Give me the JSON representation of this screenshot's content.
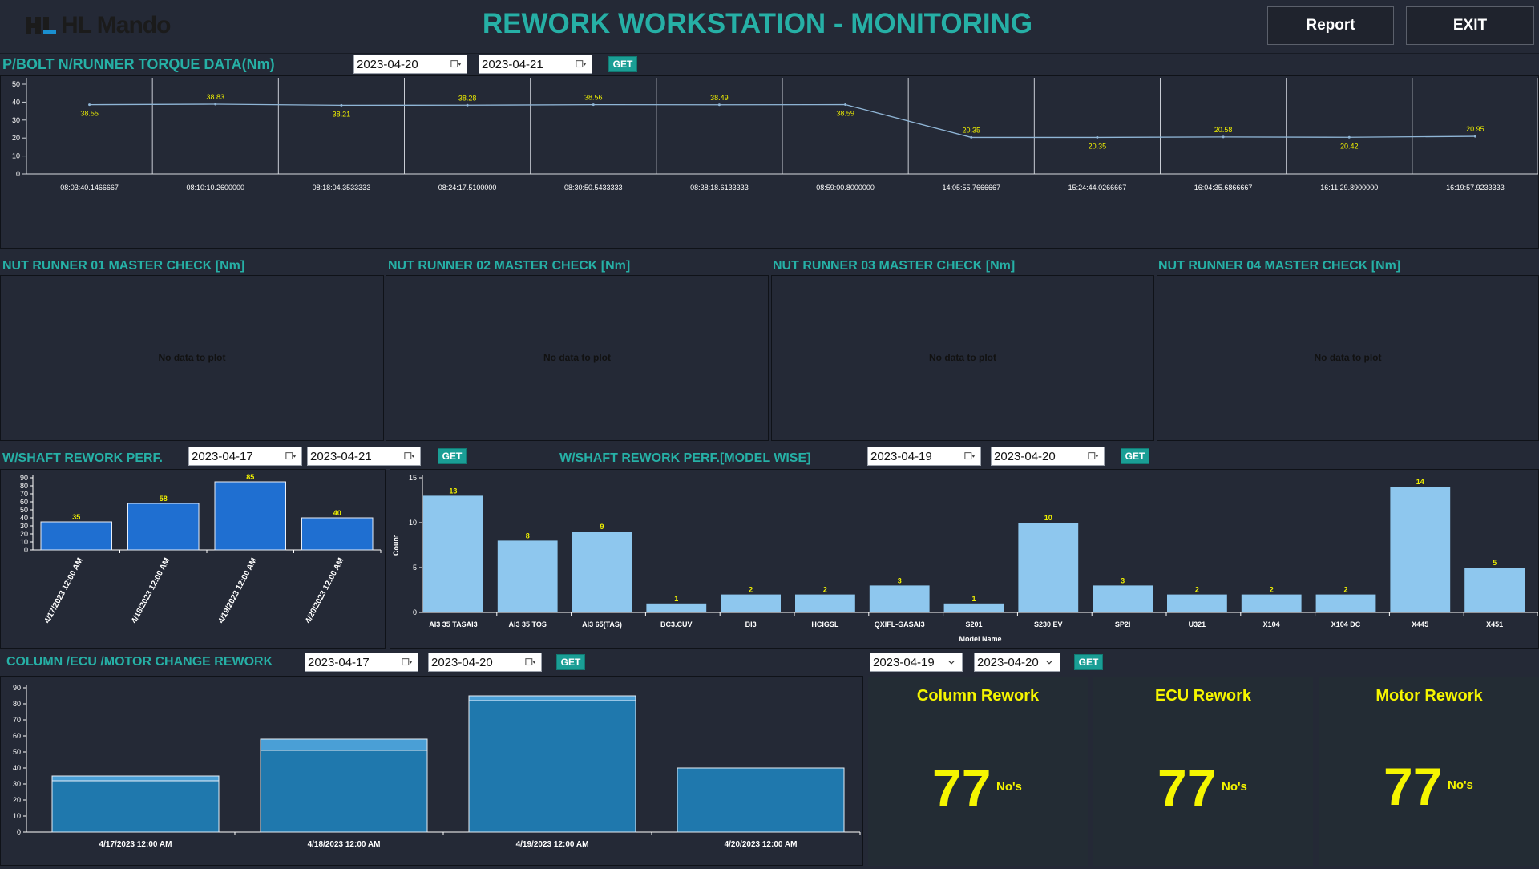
{
  "header": {
    "logo_text": "HL Mando",
    "title": "REWORK WORKSTATION - MONITORING",
    "report_label": "Report",
    "exit_label": "EXIT"
  },
  "torque": {
    "title": "P/BOLT N/RUNNER TORQUE DATA(Nm)",
    "from": "2023-04-20",
    "to": "2023-04-21",
    "get_label": "GET",
    "chart_data": {
      "type": "line",
      "x": [
        "08:03:40.1466667",
        "08:10:10.2600000",
        "08:18:04.3533333",
        "08:24:17.5100000",
        "08:30:50.5433333",
        "08:38:18.6133333",
        "08:59:00.8000000",
        "14:05:55.7666667",
        "15:24:44.0266667",
        "16:04:35.6866667",
        "16:11:29.8900000",
        "16:19:57.9233333"
      ],
      "values": [
        38.55,
        38.83,
        38.21,
        38.28,
        38.56,
        38.49,
        38.59,
        20.35,
        20.35,
        20.58,
        20.42,
        20.95
      ],
      "yticks": [
        0,
        10,
        20,
        30,
        40,
        50
      ],
      "ylim": [
        0,
        50
      ]
    }
  },
  "nutrunners": [
    {
      "title": "NUT RUNNER 01 MASTER CHECK [Nm]",
      "message": "No data to plot"
    },
    {
      "title": "NUT RUNNER 02 MASTER CHECK [Nm]",
      "message": "No data to plot"
    },
    {
      "title": "NUT RUNNER 03 MASTER CHECK [Nm]",
      "message": "No data to plot"
    },
    {
      "title": "NUT RUNNER 04 MASTER CHECK [Nm]",
      "message": "No data to plot"
    }
  ],
  "wshaft": {
    "title": "W/SHAFT REWORK PERF.",
    "from": "2023-04-17",
    "to": "2023-04-21",
    "get_label": "GET",
    "chart_data": {
      "type": "bar",
      "categories": [
        "4/17/2023 12:00 AM",
        "4/18/2023 12:00 AM",
        "4/19/2023 12:00 AM",
        "4/20/2023 12:00 AM"
      ],
      "values": [
        35,
        58,
        85,
        40
      ],
      "yticks": [
        0,
        10,
        20,
        30,
        40,
        50,
        60,
        70,
        80,
        90
      ],
      "ylim": [
        0,
        90
      ]
    }
  },
  "wshaft_model": {
    "title": "W/SHAFT REWORK PERF.[MODEL WISE]",
    "from": "2023-04-19",
    "to": "2023-04-20",
    "get_label": "GET",
    "chart_data": {
      "type": "bar",
      "categories": [
        "AI3 35 TASAI3",
        "AI3 35 TOS",
        "AI3 65(TAS)",
        "BC3.CUV",
        "BI3",
        "HCIGSL",
        "QXIFL-GASAI3",
        "S201",
        "S230 EV",
        "SP2I",
        "U321",
        "X104",
        "X104 DC",
        "X445",
        "X451"
      ],
      "values": [
        13,
        8,
        9,
        1,
        2,
        2,
        3,
        1,
        10,
        3,
        2,
        2,
        2,
        14,
        5
      ],
      "xlabel": "Model Name",
      "ylabel": "Count",
      "yticks": [
        0,
        5,
        10,
        15
      ],
      "ylim": [
        0,
        15
      ]
    }
  },
  "column_ecu": {
    "title": "COLUMN /ECU /MOTOR CHANGE REWORK",
    "from": "2023-04-17",
    "to": "2023-04-20",
    "get_label": "GET",
    "chart_data": {
      "type": "bar",
      "categories": [
        "4/17/2023 12:00 AM",
        "4/18/2023 12:00 AM",
        "4/19/2023 12:00 AM",
        "4/20/2023 12:00 AM"
      ],
      "series": [
        {
          "values": [
            32,
            51,
            82,
            40
          ]
        },
        {
          "values": [
            3,
            7,
            3,
            0
          ]
        }
      ],
      "yticks": [
        0,
        10,
        20,
        30,
        40,
        50,
        60,
        70,
        80,
        90
      ],
      "ylim": [
        0,
        90
      ]
    }
  },
  "summary": {
    "from": "2023-04-19",
    "to": "2023-04-20",
    "get_label": "GET",
    "cards": [
      {
        "title": "Column Rework",
        "value": "77",
        "unit": "No's"
      },
      {
        "title": "ECU Rework",
        "value": "77",
        "unit": "No's"
      },
      {
        "title": "Motor Rework",
        "value": "77",
        "unit": "No's"
      }
    ]
  }
}
